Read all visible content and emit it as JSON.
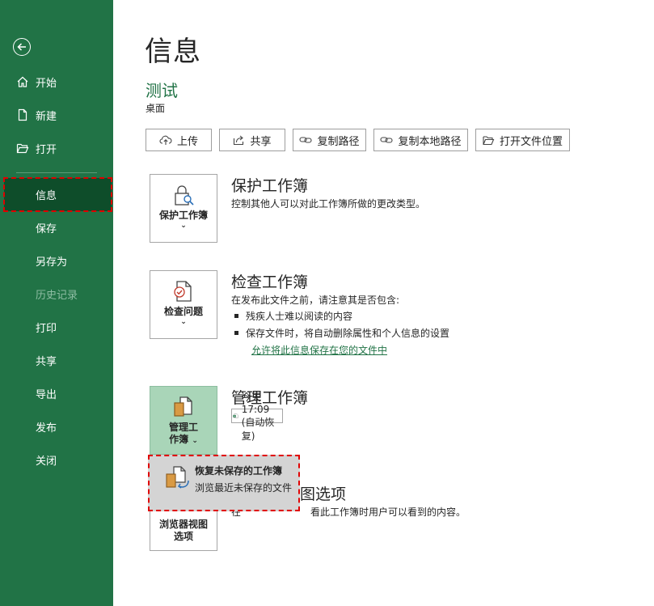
{
  "sidebar": {
    "top_items": [
      {
        "label": "开始",
        "icon": "home-icon"
      },
      {
        "label": "新建",
        "icon": "new-document-icon"
      },
      {
        "label": "打开",
        "icon": "folder-open-icon"
      }
    ],
    "bottom_items": [
      {
        "label": "信息",
        "state": "selected"
      },
      {
        "label": "保存",
        "state": "normal"
      },
      {
        "label": "另存为",
        "state": "normal"
      },
      {
        "label": "历史记录",
        "state": "disabled"
      },
      {
        "label": "打印",
        "state": "normal"
      },
      {
        "label": "共享",
        "state": "normal"
      },
      {
        "label": "导出",
        "state": "normal"
      },
      {
        "label": "发布",
        "state": "normal"
      },
      {
        "label": "关闭",
        "state": "normal"
      }
    ]
  },
  "page": {
    "title": "信息",
    "doc_name": "测试",
    "doc_location": "桌面"
  },
  "toolbar": {
    "upload": "上传",
    "share": "共享",
    "copy_path": "复制路径",
    "copy_local_path": "复制本地路径",
    "open_location": "打开文件位置"
  },
  "protect": {
    "button": "保护工作簿",
    "title": "保护工作簿",
    "desc": "控制其他人可以对此工作簿所做的更改类型。"
  },
  "inspect": {
    "button": "检查问题",
    "title": "检查工作簿",
    "desc": "在发布此文件之前，请注意其是否包含:",
    "bullets": [
      "残疾人士难以阅读的内容",
      "保存文件时，将自动删除属性和个人信息的设置"
    ],
    "link": "允许将此信息保存在您的文件中"
  },
  "manage": {
    "button_line1": "管理工",
    "button_line2": "作簿",
    "title": "管理工作簿",
    "version": "今天 17:09 (自动恢复)"
  },
  "browser": {
    "button_line1": "浏览器视图",
    "button_line2": "选项",
    "title_partial": "图选项",
    "desc_prefix": "在",
    "desc_rest": "看此工作簿时用户可以看到的内容。"
  },
  "popup": {
    "title": "恢复未保存的工作簿",
    "desc": "浏览最近未保存的文件"
  },
  "colors": {
    "sidebar_bg": "#217346",
    "sidebar_selected": "#0e4d2a",
    "accent": "#217346",
    "highlight_outline": "#e00000",
    "manage_button_bg": "#a9d5b8",
    "popup_bg": "#d4d4d4"
  }
}
